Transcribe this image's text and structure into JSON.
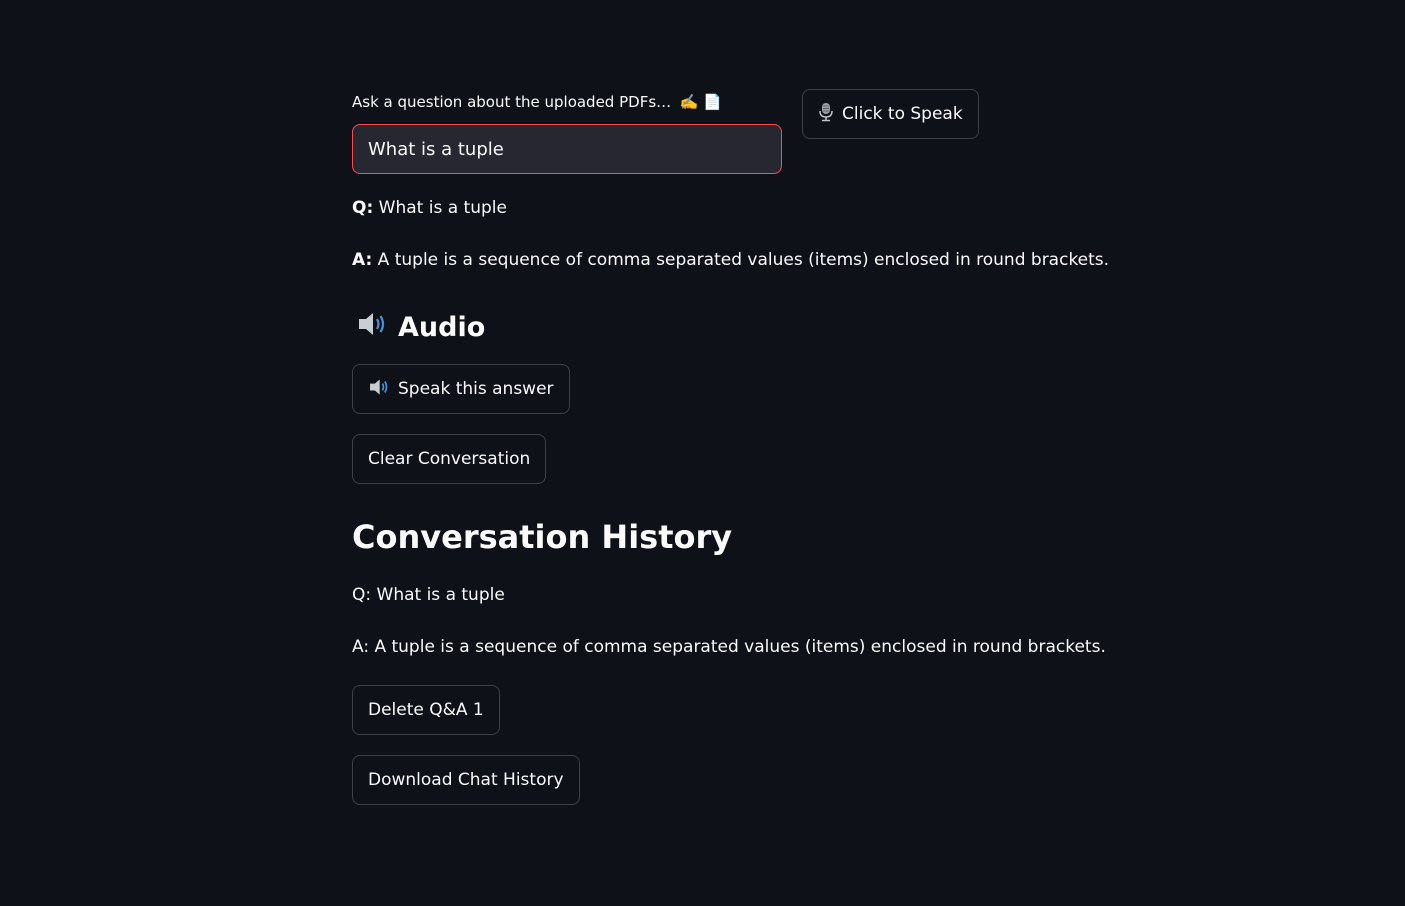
{
  "input": {
    "label": "Ask a question about the uploaded PDFs…",
    "label_emojis": "✍️ 📄",
    "value": "What is a tuple"
  },
  "speak_button": {
    "label": "Click to Speak",
    "icon": "microphone-icon"
  },
  "current": {
    "q_prefix": "Q:",
    "question": " What is a tuple",
    "a_prefix": "A:",
    "answer": " A tuple is a sequence of comma separated values (items) enclosed in round brackets."
  },
  "audio": {
    "heading": "Audio",
    "icon": "speaker-icon",
    "speak_answer_label": "Speak this answer"
  },
  "clear_label": "Clear Conversation",
  "history": {
    "heading": "Conversation History",
    "items": [
      {
        "question": "Q: What is a tuple",
        "answer": "A: A tuple is a sequence of comma separated values (items) enclosed in round brackets.",
        "delete_label": "Delete Q&A 1"
      }
    ]
  },
  "download_label": "Download Chat History",
  "colors": {
    "background": "#0e1117",
    "input_bg": "#262730",
    "accent": "#ff4b4b",
    "text": "#fafafa"
  }
}
